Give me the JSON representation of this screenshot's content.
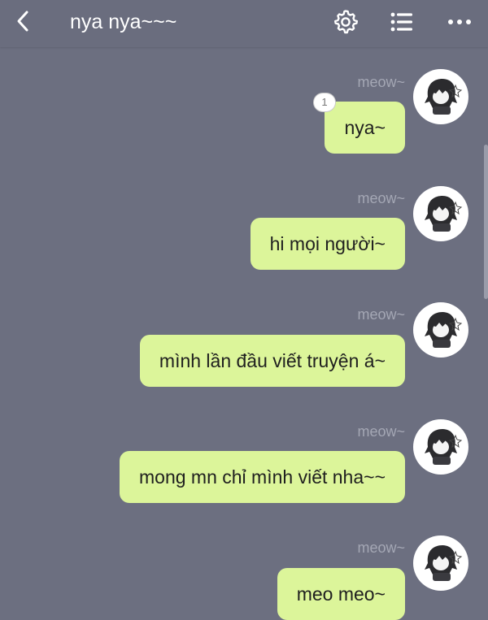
{
  "header": {
    "title": "nya nya~~~",
    "back_icon": "chevron-left-icon",
    "settings_icon": "gear-icon",
    "list_icon": "list-icon",
    "more_icon": "more-horizontal-icon"
  },
  "colors": {
    "background": "#6c6f80",
    "bubble": "#dcf59a",
    "sender_text": "#a4a7b4"
  },
  "messages": [
    {
      "sender": "meow~",
      "text": "nya~",
      "read_count": "1"
    },
    {
      "sender": "meow~",
      "text": "hi mọi người~"
    },
    {
      "sender": "meow~",
      "text": "mình lần đầu viết truyện á~"
    },
    {
      "sender": "meow~",
      "text": "mong mn chỉ mình viết nha~~"
    },
    {
      "sender": "meow~",
      "text": "meo meo~"
    }
  ]
}
